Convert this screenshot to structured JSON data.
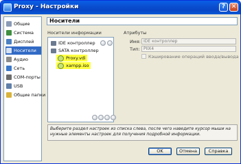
{
  "window": {
    "title": "Proxy - Настройки"
  },
  "sidebar": {
    "items": [
      {
        "label": "Общие",
        "icon": "general-icon",
        "color": "#8a9bb5"
      },
      {
        "label": "Система",
        "icon": "system-icon",
        "color": "#3f8f3f"
      },
      {
        "label": "Дисплей",
        "icon": "display-icon",
        "color": "#4a7fc1"
      },
      {
        "label": "Носители",
        "icon": "storage-icon",
        "color": "#5d6f8c",
        "selected": true
      },
      {
        "label": "Аудио",
        "icon": "audio-icon",
        "color": "#8c8c8c"
      },
      {
        "label": "Сеть",
        "icon": "network-icon",
        "color": "#3a78c9"
      },
      {
        "label": "COM-порты",
        "icon": "serial-port-icon",
        "color": "#6c6c6c"
      },
      {
        "label": "USB",
        "icon": "usb-icon",
        "color": "#5f7fa8"
      },
      {
        "label": "Общие папки",
        "icon": "shared-folders-icon",
        "color": "#d9b43b"
      }
    ]
  },
  "main": {
    "header": "Носители",
    "tree_label": "Носители информации",
    "attrs_label": "Атрибуты",
    "tree": {
      "ide_controller": "IDE контроллер",
      "sata_controller": "SATA контроллер",
      "disks": [
        "Proxy.vdi",
        "xampp.iso"
      ]
    },
    "attributes": {
      "name_label": "Имя:",
      "name_value": "IDE контроллер",
      "type_label": "Тип:",
      "type_value": "PIIX4",
      "cache_label": "Кэширование операций ввода/вывода"
    },
    "info_text": "Выберите раздел настроек из списка слева, после чего наведите курсор мыши на нужные элементы настроек для получения подробной информации."
  },
  "buttons": {
    "ok": "OK",
    "cancel": "Отмена",
    "help": "Справка"
  },
  "colors": {
    "selection": "#316ac5",
    "highlight": "#ffff3f",
    "titlebar": "#0a5fe6"
  }
}
